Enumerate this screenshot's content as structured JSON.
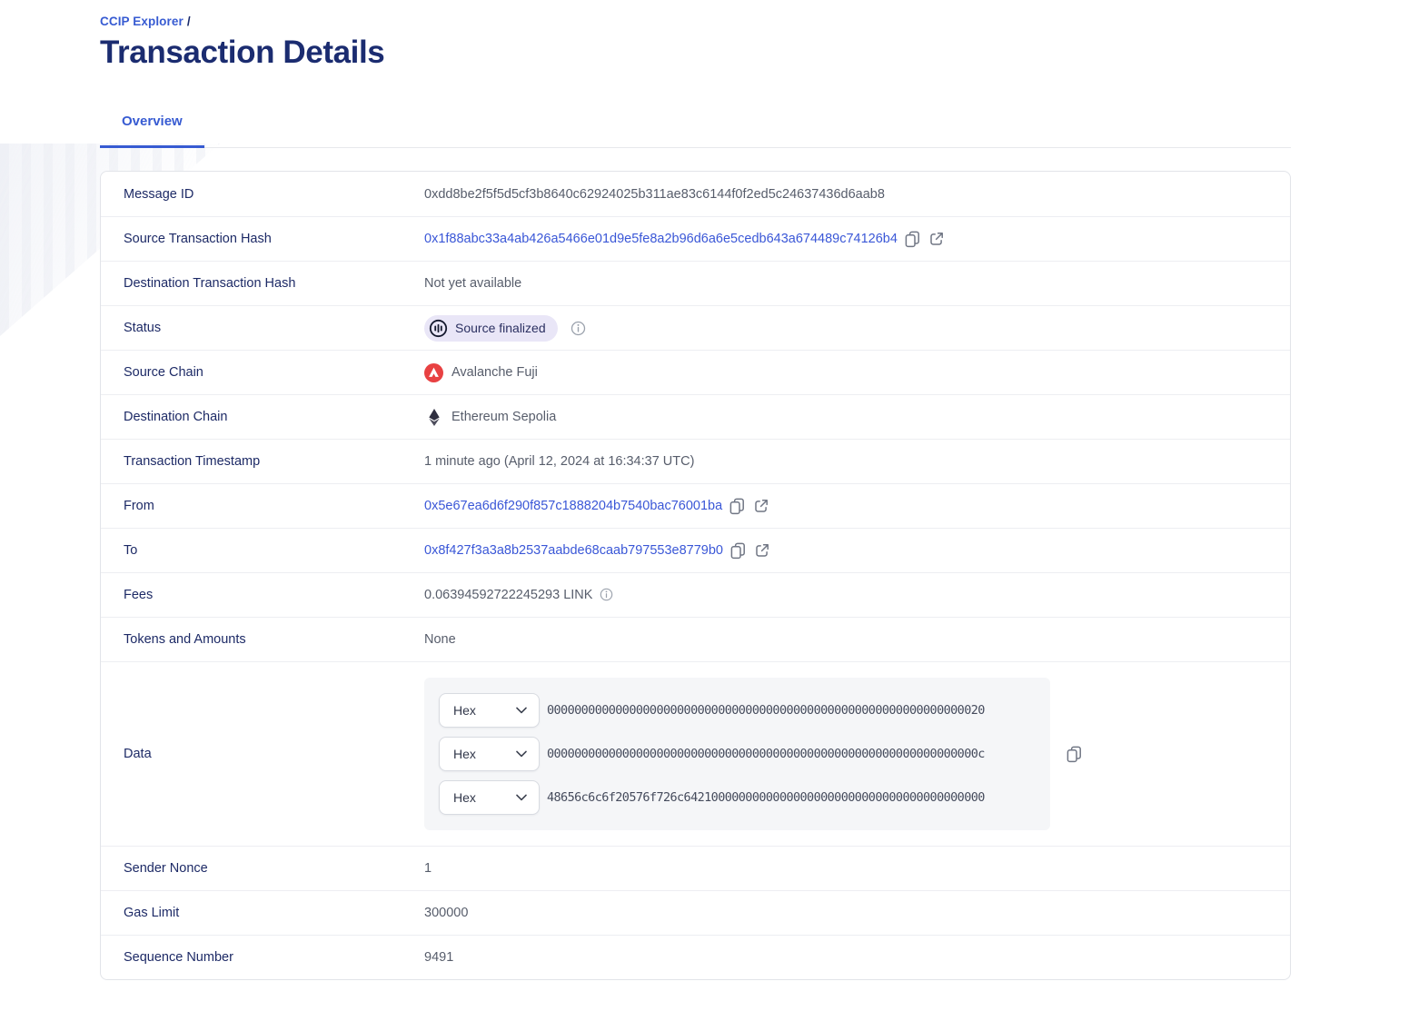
{
  "breadcrumb": {
    "link_label": "CCIP Explorer",
    "separator": "/"
  },
  "page": {
    "title": "Transaction Details"
  },
  "tabs": {
    "overview_label": "Overview"
  },
  "colors": {
    "accent_blue": "#375BD2",
    "title_navy": "#1b2c70",
    "badge_bg": "#e9e6f7",
    "avalanche_red": "#E84142",
    "value_gray": "#575d6b"
  },
  "icons": {
    "copy": "copy-icon",
    "external_link": "external-link-icon",
    "info": "info-icon",
    "status_progress": "status-progress-icon",
    "avalanche": "avalanche-icon",
    "ethereum": "ethereum-icon",
    "chevron_down": "chevron-down-icon"
  },
  "rows": {
    "message_id": {
      "label": "Message ID",
      "value": "0xdd8be2f5f5d5cf3b8640c62924025b311ae83c6144f0f2ed5c24637436d6aab8"
    },
    "source_tx": {
      "label": "Source Transaction Hash",
      "value": "0x1f88abc33a4ab426a5466e01d9e5fe8a2b96d6a6e5cedb643a674489c74126b4"
    },
    "dest_tx": {
      "label": "Destination Transaction Hash",
      "value": "Not yet available"
    },
    "status": {
      "label": "Status",
      "badge_label": "Source finalized"
    },
    "source_chain": {
      "label": "Source Chain",
      "value": "Avalanche Fuji"
    },
    "dest_chain": {
      "label": "Destination Chain",
      "value": "Ethereum Sepolia"
    },
    "timestamp": {
      "label": "Transaction Timestamp",
      "value": "1 minute ago (April 12, 2024 at 16:34:37 UTC)"
    },
    "from": {
      "label": "From",
      "value": "0x5e67ea6d6f290f857c1888204b7540bac76001ba"
    },
    "to": {
      "label": "To",
      "value": "0x8f427f3a3a8b2537aabde68caab797553e8779b0"
    },
    "fees": {
      "label": "Fees",
      "value": "0.06394592722245293 LINK"
    },
    "tokens": {
      "label": "Tokens and Amounts",
      "value": "None"
    },
    "data": {
      "label": "Data",
      "format_label": "Hex",
      "lines": [
        "0000000000000000000000000000000000000000000000000000000000000020",
        "000000000000000000000000000000000000000000000000000000000000000c",
        "48656c6c6f20576f726c64210000000000000000000000000000000000000000"
      ]
    },
    "sender_nonce": {
      "label": "Sender Nonce",
      "value": "1"
    },
    "gas_limit": {
      "label": "Gas Limit",
      "value": "300000"
    },
    "sequence_number": {
      "label": "Sequence Number",
      "value": "9491"
    }
  }
}
